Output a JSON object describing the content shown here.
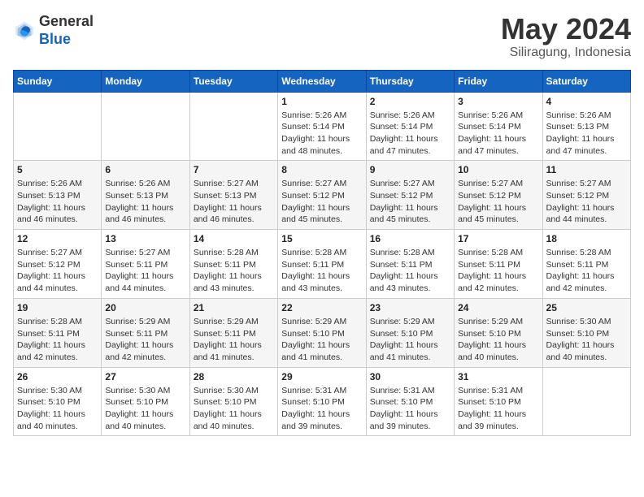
{
  "logo": {
    "general": "General",
    "blue": "Blue"
  },
  "header": {
    "month": "May 2024",
    "location": "Siliragung, Indonesia"
  },
  "weekdays": [
    "Sunday",
    "Monday",
    "Tuesday",
    "Wednesday",
    "Thursday",
    "Friday",
    "Saturday"
  ],
  "weeks": [
    [
      {
        "day": "",
        "info": ""
      },
      {
        "day": "",
        "info": ""
      },
      {
        "day": "",
        "info": ""
      },
      {
        "day": "1",
        "sunrise": "5:26 AM",
        "sunset": "5:14 PM",
        "daylight": "11 hours and 48 minutes."
      },
      {
        "day": "2",
        "sunrise": "5:26 AM",
        "sunset": "5:14 PM",
        "daylight": "11 hours and 47 minutes."
      },
      {
        "day": "3",
        "sunrise": "5:26 AM",
        "sunset": "5:14 PM",
        "daylight": "11 hours and 47 minutes."
      },
      {
        "day": "4",
        "sunrise": "5:26 AM",
        "sunset": "5:13 PM",
        "daylight": "11 hours and 47 minutes."
      }
    ],
    [
      {
        "day": "5",
        "sunrise": "5:26 AM",
        "sunset": "5:13 PM",
        "daylight": "11 hours and 46 minutes."
      },
      {
        "day": "6",
        "sunrise": "5:26 AM",
        "sunset": "5:13 PM",
        "daylight": "11 hours and 46 minutes."
      },
      {
        "day": "7",
        "sunrise": "5:27 AM",
        "sunset": "5:13 PM",
        "daylight": "11 hours and 46 minutes."
      },
      {
        "day": "8",
        "sunrise": "5:27 AM",
        "sunset": "5:12 PM",
        "daylight": "11 hours and 45 minutes."
      },
      {
        "day": "9",
        "sunrise": "5:27 AM",
        "sunset": "5:12 PM",
        "daylight": "11 hours and 45 minutes."
      },
      {
        "day": "10",
        "sunrise": "5:27 AM",
        "sunset": "5:12 PM",
        "daylight": "11 hours and 45 minutes."
      },
      {
        "day": "11",
        "sunrise": "5:27 AM",
        "sunset": "5:12 PM",
        "daylight": "11 hours and 44 minutes."
      }
    ],
    [
      {
        "day": "12",
        "sunrise": "5:27 AM",
        "sunset": "5:12 PM",
        "daylight": "11 hours and 44 minutes."
      },
      {
        "day": "13",
        "sunrise": "5:27 AM",
        "sunset": "5:11 PM",
        "daylight": "11 hours and 44 minutes."
      },
      {
        "day": "14",
        "sunrise": "5:28 AM",
        "sunset": "5:11 PM",
        "daylight": "11 hours and 43 minutes."
      },
      {
        "day": "15",
        "sunrise": "5:28 AM",
        "sunset": "5:11 PM",
        "daylight": "11 hours and 43 minutes."
      },
      {
        "day": "16",
        "sunrise": "5:28 AM",
        "sunset": "5:11 PM",
        "daylight": "11 hours and 43 minutes."
      },
      {
        "day": "17",
        "sunrise": "5:28 AM",
        "sunset": "5:11 PM",
        "daylight": "11 hours and 42 minutes."
      },
      {
        "day": "18",
        "sunrise": "5:28 AM",
        "sunset": "5:11 PM",
        "daylight": "11 hours and 42 minutes."
      }
    ],
    [
      {
        "day": "19",
        "sunrise": "5:28 AM",
        "sunset": "5:11 PM",
        "daylight": "11 hours and 42 minutes."
      },
      {
        "day": "20",
        "sunrise": "5:29 AM",
        "sunset": "5:11 PM",
        "daylight": "11 hours and 42 minutes."
      },
      {
        "day": "21",
        "sunrise": "5:29 AM",
        "sunset": "5:11 PM",
        "daylight": "11 hours and 41 minutes."
      },
      {
        "day": "22",
        "sunrise": "5:29 AM",
        "sunset": "5:10 PM",
        "daylight": "11 hours and 41 minutes."
      },
      {
        "day": "23",
        "sunrise": "5:29 AM",
        "sunset": "5:10 PM",
        "daylight": "11 hours and 41 minutes."
      },
      {
        "day": "24",
        "sunrise": "5:29 AM",
        "sunset": "5:10 PM",
        "daylight": "11 hours and 40 minutes."
      },
      {
        "day": "25",
        "sunrise": "5:30 AM",
        "sunset": "5:10 PM",
        "daylight": "11 hours and 40 minutes."
      }
    ],
    [
      {
        "day": "26",
        "sunrise": "5:30 AM",
        "sunset": "5:10 PM",
        "daylight": "11 hours and 40 minutes."
      },
      {
        "day": "27",
        "sunrise": "5:30 AM",
        "sunset": "5:10 PM",
        "daylight": "11 hours and 40 minutes."
      },
      {
        "day": "28",
        "sunrise": "5:30 AM",
        "sunset": "5:10 PM",
        "daylight": "11 hours and 40 minutes."
      },
      {
        "day": "29",
        "sunrise": "5:31 AM",
        "sunset": "5:10 PM",
        "daylight": "11 hours and 39 minutes."
      },
      {
        "day": "30",
        "sunrise": "5:31 AM",
        "sunset": "5:10 PM",
        "daylight": "11 hours and 39 minutes."
      },
      {
        "day": "31",
        "sunrise": "5:31 AM",
        "sunset": "5:10 PM",
        "daylight": "11 hours and 39 minutes."
      },
      {
        "day": "",
        "info": ""
      }
    ]
  ],
  "labels": {
    "sunrise": "Sunrise:",
    "sunset": "Sunset:",
    "daylight": "Daylight:"
  }
}
